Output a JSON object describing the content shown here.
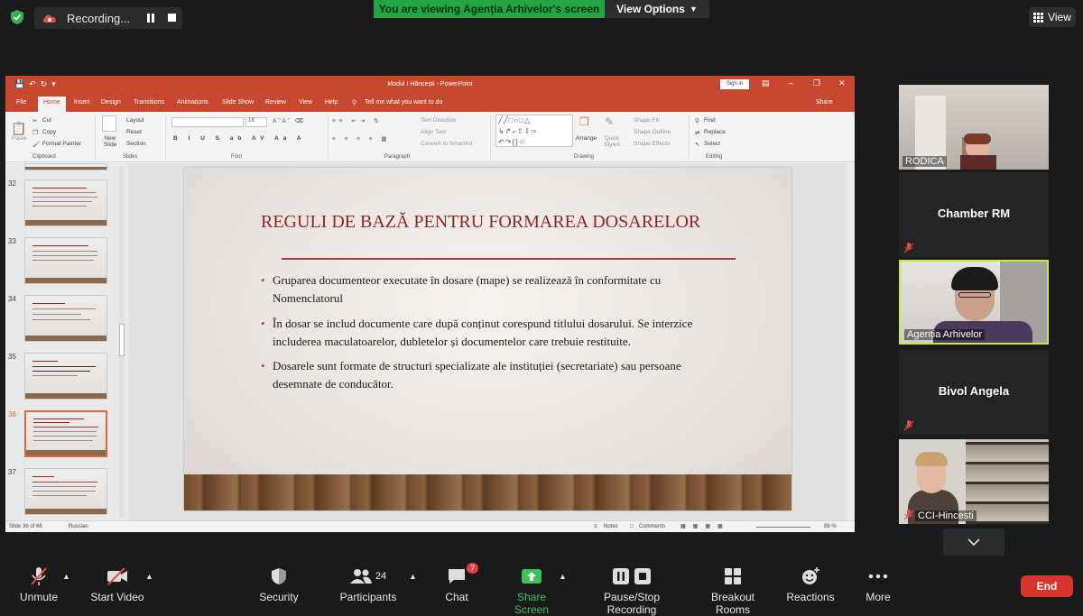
{
  "top_bar": {
    "recording_label": "Recording...",
    "viewing_banner": "You are viewing Agenția Arhivelor's screen",
    "view_options_label": "View Options",
    "view_label": "View"
  },
  "powerpoint": {
    "window_title": "Modul I Hâncești  -  PowerPoint",
    "sign_in_label": "Sign in",
    "tabs": [
      "File",
      "Home",
      "Insert",
      "Design",
      "Transitions",
      "Animations",
      "Slide Show",
      "Review",
      "View",
      "Help"
    ],
    "tell_me": "Tell me what you want to do",
    "share_label": "Share",
    "ribbon": {
      "paste": "Paste",
      "cut": "Cut",
      "copy": "Copy",
      "format_painter": "Format Painter",
      "clipboard": "Clipboard",
      "new_slide": "New Slide",
      "layout": "Layout",
      "reset": "Reset",
      "section": "Section",
      "slides": "Slides",
      "font_size": "18",
      "font": "Font",
      "text_direction": "Text Direction",
      "align_text": "Align Text",
      "convert_smartart": "Convert to SmartArt",
      "paragraph": "Paragraph",
      "arrange": "Arrange",
      "quick_styles": "Quick Styles",
      "shape_fill": "Shape Fill",
      "shape_outline": "Shape Outline",
      "shape_effects": "Shape Effects",
      "drawing": "Drawing",
      "find": "Find",
      "replace": "Replace",
      "select": "Select",
      "editing": "Editing"
    },
    "thumbnails": [
      {
        "num": "32"
      },
      {
        "num": "33"
      },
      {
        "num": "34"
      },
      {
        "num": "35"
      },
      {
        "num": "36",
        "selected": true
      },
      {
        "num": "37"
      }
    ],
    "slide": {
      "title": "REGULI DE BAZĂ PENTRU FORMAREA DOSARELOR",
      "bullets": [
        "Gruparea documenteor executate în dosare (mape) se realizează în conformitate cu Nomenclatorul",
        "În dosar se includ documente care după conținut corespund titlului dosarului. Se interzice includerea maculatoarelor, dubletelor și documentelor care trebuie restituite.",
        "Dosarele sunt formate de structuri specializate ale instituției (secretariate) sau persoane desemnate de conducător."
      ]
    },
    "status": {
      "slide_info": "Slide 36 of 66",
      "language": "Russian",
      "notes": "Notes",
      "comments": "Comments",
      "zoom": "86 %"
    }
  },
  "participants": [
    {
      "name": "RODICA",
      "video": true
    },
    {
      "name": "Chamber RM",
      "video": false
    },
    {
      "name": "Agenția Arhivelor",
      "video": true,
      "active": true
    },
    {
      "name": "Bivol Angela",
      "video": false
    },
    {
      "name": "CCI-Hincesti",
      "video": true
    }
  ],
  "toolbar": {
    "unmute": "Unmute",
    "start_video": "Start Video",
    "security": "Security",
    "participants": "Participants",
    "participants_count": "24",
    "chat": "Chat",
    "chat_badge": "7",
    "share_screen": "Share Screen",
    "pause_recording": "Pause/Stop Recording",
    "breakout": "Breakout Rooms",
    "reactions": "Reactions",
    "more": "More",
    "end": "End"
  },
  "colors": {
    "ppt_accent": "#c8482f",
    "share_green": "#3fc15a",
    "end_red": "#d9342b",
    "active_speaker": "#c6e84a"
  }
}
